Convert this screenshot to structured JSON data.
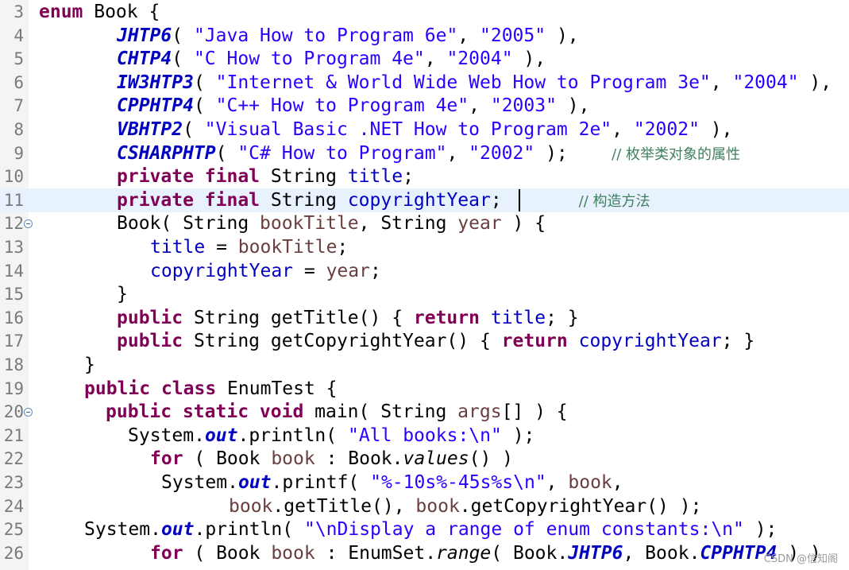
{
  "editor": {
    "lines": [
      {
        "num": "3",
        "tokens": [
          {
            "t": "enum",
            "c": "kw"
          },
          {
            "t": " Book {",
            "c": "pl"
          }
        ]
      },
      {
        "num": "4",
        "tokens": [
          {
            "t": "JHTP6",
            "c": "ec"
          },
          {
            "t": "( ",
            "c": "pl"
          },
          {
            "t": "\"Java How to Program 6e\"",
            "c": "str"
          },
          {
            "t": ", ",
            "c": "pl"
          },
          {
            "t": "\"2005\"",
            "c": "str"
          },
          {
            "t": " ),",
            "c": "pl"
          }
        ]
      },
      {
        "num": "5",
        "tokens": [
          {
            "t": "CHTP4",
            "c": "ec"
          },
          {
            "t": "( ",
            "c": "pl"
          },
          {
            "t": "\"C How to Program 4e\"",
            "c": "str"
          },
          {
            "t": ", ",
            "c": "pl"
          },
          {
            "t": "\"2004\"",
            "c": "str"
          },
          {
            "t": " ),",
            "c": "pl"
          }
        ]
      },
      {
        "num": "6",
        "tokens": [
          {
            "t": "IW3HTP3",
            "c": "ec"
          },
          {
            "t": "( ",
            "c": "pl"
          },
          {
            "t": "\"Internet & World Wide Web How to Program 3e\"",
            "c": "str"
          },
          {
            "t": ", ",
            "c": "pl"
          },
          {
            "t": "\"2004\"",
            "c": "str"
          },
          {
            "t": " ),",
            "c": "pl"
          }
        ]
      },
      {
        "num": "7",
        "tokens": [
          {
            "t": "CPPHTP4",
            "c": "ec"
          },
          {
            "t": "( ",
            "c": "pl"
          },
          {
            "t": "\"C++ How to Program 4e\"",
            "c": "str"
          },
          {
            "t": ", ",
            "c": "pl"
          },
          {
            "t": "\"2003\"",
            "c": "str"
          },
          {
            "t": " ),",
            "c": "pl"
          }
        ]
      },
      {
        "num": "8",
        "tokens": [
          {
            "t": "VBHTP2",
            "c": "ec"
          },
          {
            "t": "( ",
            "c": "pl"
          },
          {
            "t": "\"Visual Basic .NET How to Program 2e\"",
            "c": "str"
          },
          {
            "t": ", ",
            "c": "pl"
          },
          {
            "t": "\"2002\"",
            "c": "str"
          },
          {
            "t": " ),",
            "c": "pl"
          }
        ]
      },
      {
        "num": "9",
        "tokens": [
          {
            "t": "CSHARPHTP",
            "c": "ec"
          },
          {
            "t": "( ",
            "c": "pl"
          },
          {
            "t": "\"C# How to Program\"",
            "c": "str"
          },
          {
            "t": ", ",
            "c": "pl"
          },
          {
            "t": "\"2002\"",
            "c": "str"
          },
          {
            "t": " );    ",
            "c": "pl"
          },
          {
            "t": "// 枚举类对象的属性",
            "c": "cm"
          }
        ]
      },
      {
        "num": "10",
        "tokens": [
          {
            "t": "private",
            "c": "kw"
          },
          {
            "t": " ",
            "c": "pl"
          },
          {
            "t": "final",
            "c": "kw"
          },
          {
            "t": " String ",
            "c": "pl"
          },
          {
            "t": "title",
            "c": "fld"
          },
          {
            "t": ";",
            "c": "pl"
          }
        ]
      },
      {
        "num": "11",
        "tokens": [
          {
            "t": "private",
            "c": "kw"
          },
          {
            "t": " ",
            "c": "pl"
          },
          {
            "t": "final",
            "c": "kw"
          },
          {
            "t": " String ",
            "c": "pl"
          },
          {
            "t": "copyrightYear",
            "c": "fld"
          },
          {
            "t": ";       ",
            "c": "pl"
          },
          {
            "t": "// 构造方法",
            "c": "cm"
          }
        ]
      },
      {
        "num": "12",
        "tokens": [
          {
            "t": "Book( String ",
            "c": "pl"
          },
          {
            "t": "bookTitle",
            "c": "loc"
          },
          {
            "t": ", String ",
            "c": "pl"
          },
          {
            "t": "year",
            "c": "loc"
          },
          {
            "t": " ) {",
            "c": "pl"
          }
        ]
      },
      {
        "num": "13",
        "tokens": [
          {
            "t": "title",
            "c": "fld"
          },
          {
            "t": " = ",
            "c": "pl"
          },
          {
            "t": "bookTitle",
            "c": "loc"
          },
          {
            "t": ";",
            "c": "pl"
          }
        ]
      },
      {
        "num": "14",
        "tokens": [
          {
            "t": "copyrightYear",
            "c": "fld"
          },
          {
            "t": " = ",
            "c": "pl"
          },
          {
            "t": "year",
            "c": "loc"
          },
          {
            "t": ";",
            "c": "pl"
          }
        ]
      },
      {
        "num": "15",
        "tokens": [
          {
            "t": "}",
            "c": "pl"
          }
        ]
      },
      {
        "num": "16",
        "tokens": [
          {
            "t": "public",
            "c": "kw"
          },
          {
            "t": " String getTitle() { ",
            "c": "pl"
          },
          {
            "t": "return",
            "c": "kw"
          },
          {
            "t": " ",
            "c": "pl"
          },
          {
            "t": "title",
            "c": "fld"
          },
          {
            "t": "; }",
            "c": "pl"
          }
        ]
      },
      {
        "num": "17",
        "tokens": [
          {
            "t": "public",
            "c": "kw"
          },
          {
            "t": " String getCopyrightYear() { ",
            "c": "pl"
          },
          {
            "t": "return",
            "c": "kw"
          },
          {
            "t": " ",
            "c": "pl"
          },
          {
            "t": "copyrightYear",
            "c": "fld"
          },
          {
            "t": "; }",
            "c": "pl"
          }
        ]
      },
      {
        "num": "18",
        "tokens": [
          {
            "t": "}",
            "c": "pl"
          }
        ]
      },
      {
        "num": "19",
        "tokens": [
          {
            "t": "public",
            "c": "kw"
          },
          {
            "t": " ",
            "c": "pl"
          },
          {
            "t": "class",
            "c": "kw"
          },
          {
            "t": " EnumTest {",
            "c": "pl"
          }
        ]
      },
      {
        "num": "20",
        "tokens": [
          {
            "t": "public",
            "c": "kw"
          },
          {
            "t": " ",
            "c": "pl"
          },
          {
            "t": "static",
            "c": "kw"
          },
          {
            "t": " ",
            "c": "pl"
          },
          {
            "t": "void",
            "c": "kw"
          },
          {
            "t": " main( String ",
            "c": "pl"
          },
          {
            "t": "args",
            "c": "loc"
          },
          {
            "t": "[] ) {",
            "c": "pl"
          }
        ]
      },
      {
        "num": "21",
        "tokens": [
          {
            "t": "System.",
            "c": "pl"
          },
          {
            "t": "out",
            "c": "st"
          },
          {
            "t": ".println( ",
            "c": "pl"
          },
          {
            "t": "\"All books:\\n\"",
            "c": "str"
          },
          {
            "t": " );",
            "c": "pl"
          }
        ]
      },
      {
        "num": "22",
        "tokens": [
          {
            "t": "for",
            "c": "kw"
          },
          {
            "t": " ( Book ",
            "c": "pl"
          },
          {
            "t": "book",
            "c": "loc"
          },
          {
            "t": " : Book.",
            "c": "pl"
          },
          {
            "t": "values",
            "c": "stm"
          },
          {
            "t": "() )",
            "c": "pl"
          }
        ]
      },
      {
        "num": "23",
        "tokens": [
          {
            "t": "System.",
            "c": "pl"
          },
          {
            "t": "out",
            "c": "st"
          },
          {
            "t": ".printf( ",
            "c": "pl"
          },
          {
            "t": "\"%-10s%-45s%s\\n\"",
            "c": "str"
          },
          {
            "t": ", ",
            "c": "pl"
          },
          {
            "t": "book",
            "c": "loc"
          },
          {
            "t": ",",
            "c": "pl"
          }
        ]
      },
      {
        "num": "24",
        "tokens": [
          {
            "t": "book",
            "c": "loc"
          },
          {
            "t": ".getTitle(), ",
            "c": "pl"
          },
          {
            "t": "book",
            "c": "loc"
          },
          {
            "t": ".getCopyrightYear() );",
            "c": "pl"
          }
        ]
      },
      {
        "num": "25",
        "tokens": [
          {
            "t": "System.",
            "c": "pl"
          },
          {
            "t": "out",
            "c": "st"
          },
          {
            "t": ".println( ",
            "c": "pl"
          },
          {
            "t": "\"\\nDisplay a range of enum constants:\\n\"",
            "c": "str"
          },
          {
            "t": " );",
            "c": "pl"
          }
        ]
      },
      {
        "num": "26",
        "tokens": [
          {
            "t": "for",
            "c": "kw"
          },
          {
            "t": " ( Book ",
            "c": "pl"
          },
          {
            "t": "book",
            "c": "loc"
          },
          {
            "t": " : EnumSet.",
            "c": "pl"
          },
          {
            "t": "range",
            "c": "stm"
          },
          {
            "t": "( Book.",
            "c": "pl"
          },
          {
            "t": "JHTP6",
            "c": "ec"
          },
          {
            "t": ", Book.",
            "c": "pl"
          },
          {
            "t": "CPPHTP4",
            "c": "ec"
          },
          {
            "t": " ) )",
            "c": "pl"
          }
        ]
      }
    ]
  },
  "watermark": "CSDN @信知阁"
}
